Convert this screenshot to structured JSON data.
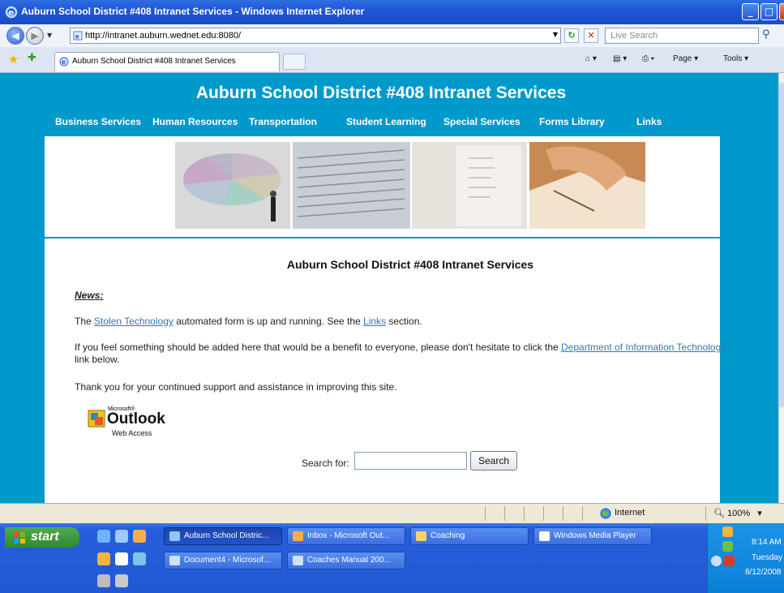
{
  "window": {
    "title": "Auburn School District #408 Intranet Services - Windows Internet Explorer",
    "minimize": "_",
    "maximize": "□",
    "close": "X"
  },
  "addressbar": {
    "url": "http://intranet.auburn.wednet.edu:8080/",
    "search_placeholder": "Live Search"
  },
  "tabs": {
    "active_label": "Auburn School District #408 Intranet Services"
  },
  "commands": {
    "page": "Page ▾",
    "tools": "Tools ▾"
  },
  "page": {
    "site_title": "Auburn School District #408 Intranet Services",
    "nav": [
      "Business Services",
      "Human Resources",
      "Transportation",
      "Student Learning",
      "Special Services",
      "Forms Library",
      "Links"
    ],
    "content_title": "Auburn School District #408 Intranet Services",
    "news_heading": "News:",
    "news1_pre": "The ",
    "news1_link1": "Stolen Technology",
    "news1_mid": " automated form is up and running.  See the ",
    "news1_link2": "Links",
    "news1_post": " section.",
    "news2_pre": "If you feel something should be added here that would be a benefit to everyone, please don't hesitate to click the ",
    "news2_link": "Department of Information Technology",
    "news2_post": "link below.",
    "news3": "Thank you for your continued support and assistance in improving this site.",
    "owa_small": "Microsoft®",
    "owa_big": "Outlook",
    "owa_sub": "Web Access",
    "search_label": "Search for:",
    "search_value": "",
    "search_button": "Search"
  },
  "statusbar": {
    "zone": "Internet",
    "zoom": "100%"
  },
  "taskbar": {
    "start": "start",
    "tasks": [
      "Auburn School Distric...",
      "Inbox - Microsoft Out...",
      "Coaching",
      "Windows Media Player",
      "Document4 - Microsof...",
      "Coaches Manual 200..."
    ],
    "clock_time": "8:14 AM",
    "clock_day": "Tuesday",
    "clock_date": "8/12/2008"
  }
}
